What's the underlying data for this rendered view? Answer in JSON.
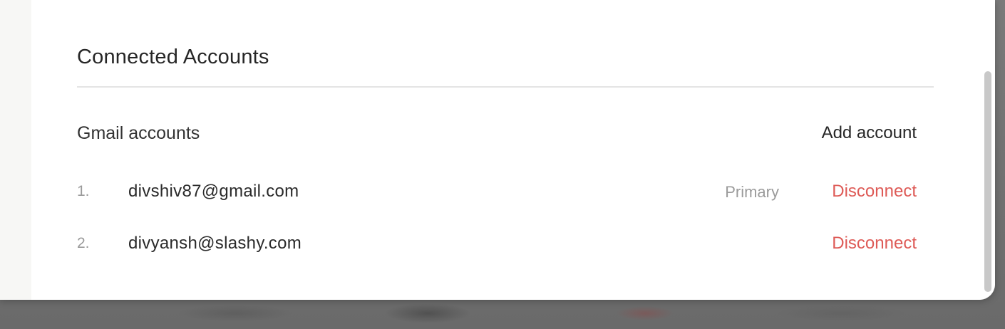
{
  "settings": {
    "section_title": "Connected Accounts",
    "subsection_title": "Gmail accounts",
    "add_account_label": "Add account",
    "accounts": [
      {
        "index": "1.",
        "email": "divshiv87@gmail.com",
        "badge": "Primary",
        "action_label": "Disconnect"
      },
      {
        "index": "2.",
        "email": "divyansh@slashy.com",
        "badge": "",
        "action_label": "Disconnect"
      }
    ]
  },
  "colors": {
    "disconnect": "#de5b57",
    "badge": "#9b9b9b",
    "title": "#262626",
    "panel": "#ffffff",
    "sidebar": "#f7f7f5"
  }
}
